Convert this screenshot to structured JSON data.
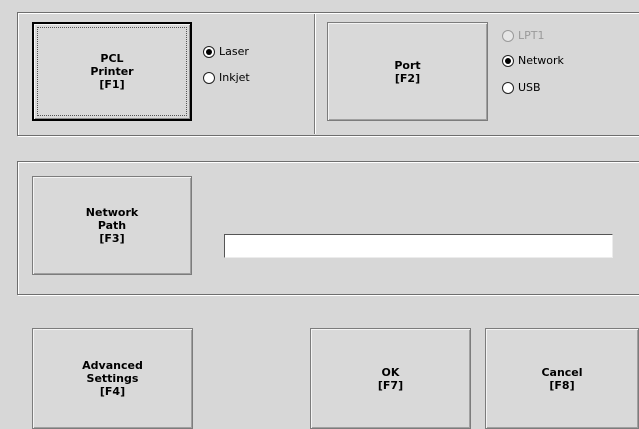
{
  "printer_group": {
    "pcl_button_label": "PCL\nPrinter\n[F1]",
    "type_options": [
      {
        "label": "Laser",
        "checked": true
      },
      {
        "label": "Inkjet",
        "checked": false
      }
    ]
  },
  "port_group": {
    "port_button_label": "Port\n[F2]",
    "options": [
      {
        "label": "LPT1",
        "checked": false,
        "disabled": true
      },
      {
        "label": "Network",
        "checked": true,
        "disabled": false
      },
      {
        "label": "USB",
        "checked": false,
        "disabled": false
      }
    ]
  },
  "network_group": {
    "path_button_label": "Network\nPath\n[F3]",
    "path_value": ""
  },
  "bottom_buttons": {
    "advanced_label": "Advanced\nSettings\n[F4]",
    "ok_label": "OK\n[F7]",
    "cancel_label": "Cancel\n[F8]"
  }
}
